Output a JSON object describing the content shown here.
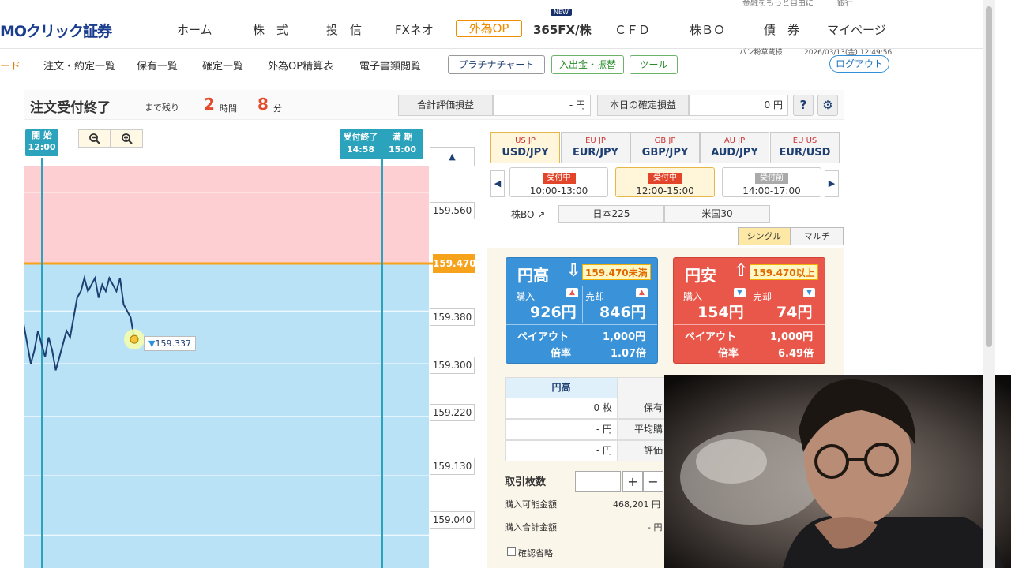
{
  "header": {
    "logo_text": "MOクリック証券",
    "nav": [
      "ホーム",
      "株　式",
      "投　信",
      "FXネオ",
      "外為OP",
      "365FX/株",
      "ＣＦＤ",
      "株ＢＯ",
      "債　券",
      "マイページ"
    ],
    "new_badge": "NEW",
    "top_right": "金融をもっと自由に　　　銀行"
  },
  "subnav": {
    "items": [
      "ード",
      "注文・約定一覧",
      "保有一覧",
      "確定一覧",
      "外為OP精算表",
      "電子書類閲覧"
    ],
    "buttons": [
      "プラチナチャート",
      "入出金・振替",
      "ツール"
    ],
    "user": "パン粉草蔵様",
    "datetime": "2026/03/13(金) 12:49:56",
    "logout": "ログアウト"
  },
  "order": {
    "title": "注文受付終了",
    "remain_label": "まで残り",
    "hours": "2",
    "hours_unit": "時間",
    "minutes": "8",
    "minutes_unit": "分",
    "total_pl_label": "合計評価損益",
    "total_pl_value": "- 円",
    "today_pl_label": "本日の確定損益",
    "today_pl_value": "0 円",
    "help_icon": "?",
    "settings_icon": "⚙"
  },
  "chart": {
    "start_label": "開 始",
    "start_time": "12:00",
    "close_label": "受付終了",
    "close_time": "14:58",
    "expiry_label": "満 期",
    "expiry_time": "15:00",
    "strike": "159.470",
    "current_price": "159.337",
    "y_labels": [
      "159.560",
      "159.380",
      "159.300",
      "159.220",
      "159.130",
      "159.040"
    ]
  },
  "chart_data": {
    "type": "line",
    "strike": 159.47,
    "current": 159.337,
    "ylim": [
      158.99,
      159.67
    ],
    "values": [
      159.36,
      159.33,
      159.3,
      159.32,
      159.35,
      159.33,
      159.31,
      159.34,
      159.32,
      159.29,
      159.31,
      159.33,
      159.35,
      159.34,
      159.37,
      159.4,
      159.41,
      159.43,
      159.41,
      159.42,
      159.43,
      159.4,
      159.42,
      159.41,
      159.43,
      159.42,
      159.41,
      159.43,
      159.39,
      159.38,
      159.37,
      159.337
    ]
  },
  "pairs": [
    {
      "label": "USD/JPY",
      "flags": "US JP",
      "active": true
    },
    {
      "label": "EUR/JPY",
      "flags": "EU JP",
      "active": false
    },
    {
      "label": "GBP/JPY",
      "flags": "GB JP",
      "active": false
    },
    {
      "label": "AUD/JPY",
      "flags": "AU JP",
      "active": false
    },
    {
      "label": "EUR/USD",
      "flags": "EU US",
      "active": false
    }
  ],
  "sessions": [
    {
      "status": "受付中",
      "time": "10:00-13:00"
    },
    {
      "status": "受付中",
      "time": "12:00-15:00"
    },
    {
      "status": "受付前",
      "time": "14:00-17:00"
    }
  ],
  "kabubo": {
    "label": "株BO",
    "buttons": [
      "日本225",
      "米国30"
    ]
  },
  "mode": {
    "single": "シングル",
    "multi": "マルチ"
  },
  "high_card": {
    "title": "円高",
    "condition": "159.470未満",
    "buy_label": "購入",
    "sell_label": "売却",
    "buy_price": "926円",
    "sell_price": "846円",
    "payout_label": "ペイアウト",
    "payout_value": "1,000円",
    "ratio_label": "倍率",
    "ratio_value": "1.07倍"
  },
  "low_card": {
    "title": "円安",
    "condition": "159.470以上",
    "buy_label": "購入",
    "sell_label": "売却",
    "buy_price": "154円",
    "sell_price": "74円",
    "payout_label": "ペイアウト",
    "payout_value": "1,000円",
    "ratio_label": "倍率",
    "ratio_value": "6.49倍"
  },
  "position": {
    "header": "円高",
    "rows": [
      {
        "value": "0 枚",
        "label": "保有"
      },
      {
        "value": "- 円",
        "label": "平均購"
      },
      {
        "value": "- 円",
        "label": "評価"
      }
    ],
    "trade_label": "取引枚数",
    "plus": "+",
    "minus": "−",
    "available_label": "購入可能金額",
    "available_value": "468,201 円",
    "total_label": "購入合計金額",
    "total_value": "- 円",
    "confirm_skip": "確認省略"
  },
  "colors": {
    "itm_zone": "#b9e2f6",
    "otm_zone": "#fdcfd2",
    "strike_line": "#f6a21a",
    "time_line": "#2ba3bd",
    "price_line": "#1e3f72",
    "high_card": "#3a93d8",
    "low_card": "#e8574a"
  }
}
